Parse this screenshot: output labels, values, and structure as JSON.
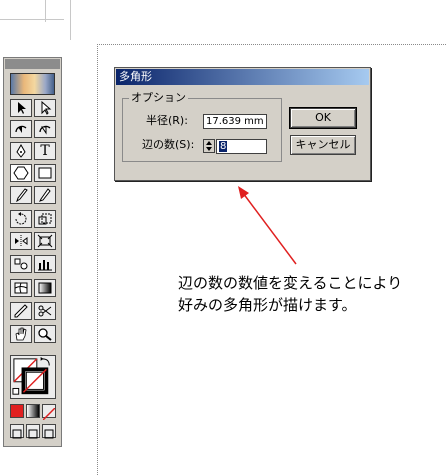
{
  "dialog": {
    "title": "多角形",
    "group_label": "オプション",
    "radius_label": "半径(R):",
    "radius_value": "17.639 mm",
    "sides_label": "辺の数(S):",
    "sides_value": "8",
    "ok_label": "OK",
    "cancel_label": "キャンセル"
  },
  "annotation": {
    "line1": "辺の数の数値を変えることにより",
    "line2": "好みの多角形が描けます。",
    "arrow_color": "#e02020"
  },
  "toolbox": {
    "type_tool_label": "T"
  }
}
